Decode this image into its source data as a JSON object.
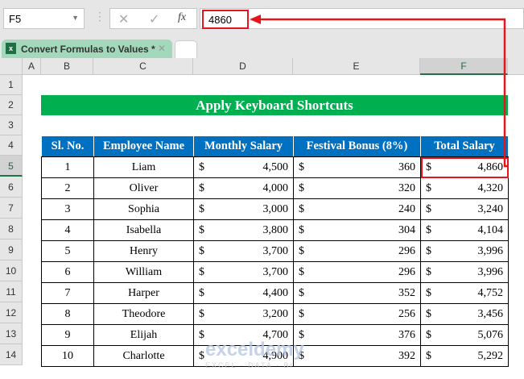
{
  "name_box": "F5",
  "formula_bar": {
    "cancel_icon": "✕",
    "enter_icon": "✓",
    "fx_icon": "fx",
    "value": "4860"
  },
  "sheet_tab": {
    "label": "Convert Formulas to Values *"
  },
  "columns": [
    "A",
    "B",
    "C",
    "D",
    "E",
    "F"
  ],
  "rows": [
    "1",
    "2",
    "3",
    "4",
    "5",
    "6",
    "7",
    "8",
    "9",
    "10",
    "11",
    "12",
    "13",
    "14"
  ],
  "title": "Apply Keyboard Shortcuts",
  "headers": [
    "Sl. No.",
    "Employee Name",
    "Monthly Salary",
    "Festival Bonus (8%)",
    "Total Salary"
  ],
  "currency": "$",
  "records": [
    [
      "1",
      "Liam",
      "4,500",
      "360",
      "4,860"
    ],
    [
      "2",
      "Oliver",
      "4,000",
      "320",
      "4,320"
    ],
    [
      "3",
      "Sophia",
      "3,000",
      "240",
      "3,240"
    ],
    [
      "4",
      "Isabella",
      "3,800",
      "304",
      "4,104"
    ],
    [
      "5",
      "Henry",
      "3,700",
      "296",
      "3,996"
    ],
    [
      "6",
      "William",
      "3,700",
      "296",
      "3,996"
    ],
    [
      "7",
      "Harper",
      "4,400",
      "352",
      "4,752"
    ],
    [
      "8",
      "Theodore",
      "3,200",
      "256",
      "3,456"
    ],
    [
      "9",
      "Elijah",
      "4,700",
      "376",
      "5,076"
    ],
    [
      "10",
      "Charlotte",
      "4,900",
      "392",
      "5,292"
    ]
  ],
  "watermark": "exceldemy",
  "watermark_sub": "EXCEL · DATA · BI",
  "colors": {
    "title_bg": "#00b050",
    "header_bg": "#0070c0",
    "highlight": "#e8141d"
  }
}
